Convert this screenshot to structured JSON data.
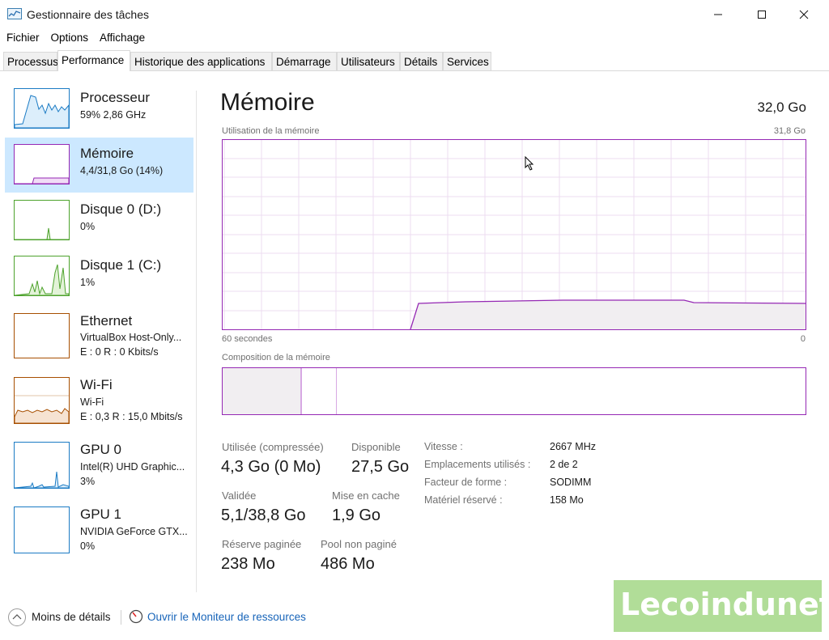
{
  "window": {
    "title": "Gestionnaire des tâches"
  },
  "menu": [
    "Fichier",
    "Options",
    "Affichage"
  ],
  "tabs": [
    "Processus",
    "Performance",
    "Historique des applications",
    "Démarrage",
    "Utilisateurs",
    "Détails",
    "Services"
  ],
  "active_tab": "Performance",
  "sidebar": {
    "items": [
      {
        "title": "Processeur",
        "lines": [
          "59%  2,86 GHz"
        ],
        "color": "#1b7bc4"
      },
      {
        "title": "Mémoire",
        "lines": [
          "4,4/31,8 Go (14%)"
        ],
        "color": "#9528b4",
        "selected": true
      },
      {
        "title": "Disque 0 (D:)",
        "lines": [
          "0%"
        ],
        "color": "#4da22c"
      },
      {
        "title": "Disque 1 (C:)",
        "lines": [
          "1%"
        ],
        "color": "#4da22c"
      },
      {
        "title": "Ethernet",
        "lines": [
          "VirtualBox Host-Only...",
          "E : 0  R : 0 Kbits/s"
        ],
        "color": "#a74f01"
      },
      {
        "title": "Wi-Fi",
        "lines": [
          "Wi-Fi",
          "E : 0,3  R : 15,0 Mbits/s"
        ],
        "color": "#a74f01"
      },
      {
        "title": "GPU 0",
        "lines": [
          "Intel(R) UHD Graphic...",
          "3%"
        ],
        "color": "#1b7bc4"
      },
      {
        "title": "GPU 1",
        "lines": [
          "NVIDIA GeForce GTX...",
          "0%"
        ],
        "color": "#1b7bc4"
      }
    ]
  },
  "main": {
    "title": "Mémoire",
    "total": "32,0 Go",
    "usage_label": "Utilisation de la mémoire",
    "usage_max": "31,8 Go",
    "time_left": "60 secondes",
    "time_right": "0",
    "composition_label": "Composition de la mémoire",
    "accent": "#9528b4"
  },
  "stats": {
    "used_label": "Utilisée (compressée)",
    "used_value": "4,3 Go (0 Mo)",
    "available_label": "Disponible",
    "available_value": "27,5 Go",
    "committed_label": "Validée",
    "committed_value": "5,1/38,8 Go",
    "cached_label": "Mise en cache",
    "cached_value": "1,9 Go",
    "paged_label": "Réserve paginée",
    "paged_value": "238 Mo",
    "nonpaged_label": "Pool non paginé",
    "nonpaged_value": "486 Mo"
  },
  "details": [
    {
      "label": "Vitesse :",
      "value": "2667 MHz"
    },
    {
      "label": "Emplacements utilisés :",
      "value": "2 de 2"
    },
    {
      "label": "Facteur de forme :",
      "value": "SODIMM"
    },
    {
      "label": "Matériel réservé :",
      "value": "158 Mo"
    }
  ],
  "footer": {
    "less_details": "Moins de détails",
    "resource_monitor": "Ouvrir le Moniteur de ressources"
  },
  "watermark": "Lecoindunet"
}
